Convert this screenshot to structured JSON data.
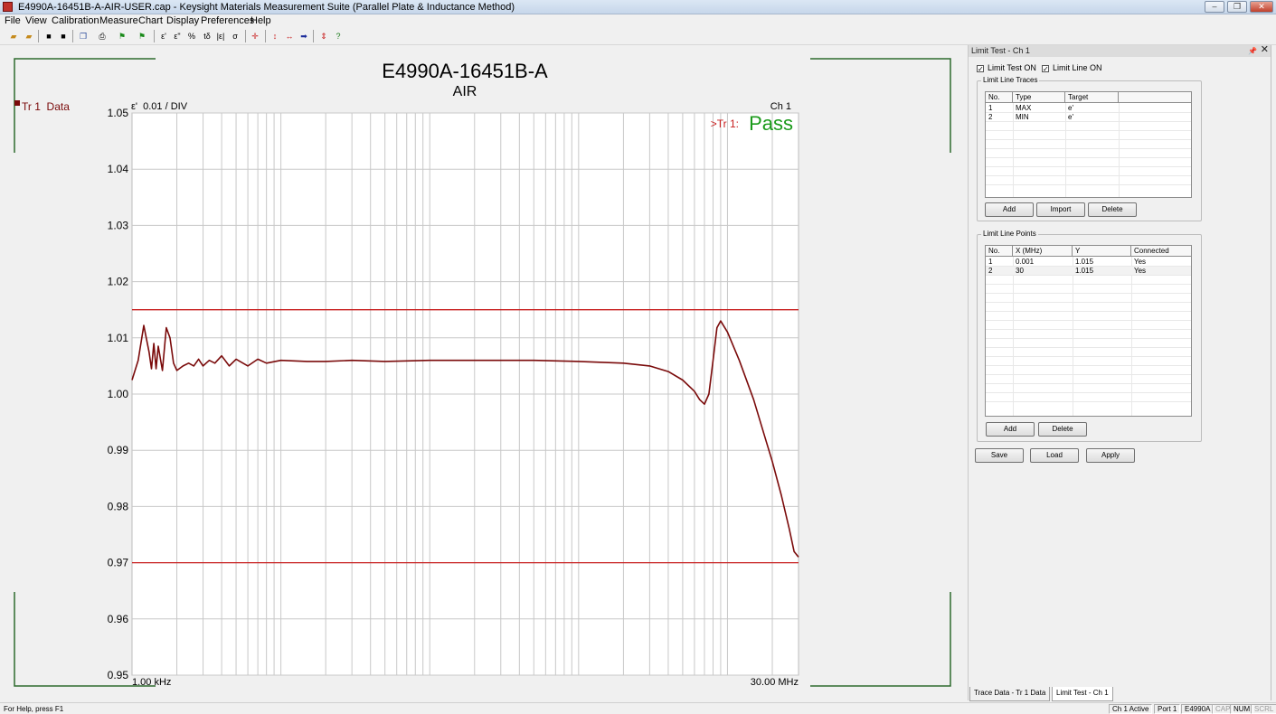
{
  "window": {
    "title": "E4990A-16451B-A-AIR-USER.cap - Keysight Materials Measurement Suite (Parallel Plate & Inductance Method)",
    "controls": [
      "minimize",
      "restore",
      "close"
    ]
  },
  "menu": [
    "File",
    "View",
    "Calibration",
    "Measure",
    "Chart",
    "Display",
    "Preferences",
    "Help"
  ],
  "toolbar": {
    "buttons": [
      "open-icon",
      "open-folder-icon",
      "save-icon",
      "save-as-icon",
      "copy-icon",
      "print-icon",
      "flag-green-icon",
      "flag-red-icon",
      "e-prime-icon",
      "e-double-prime-icon",
      "percent-icon",
      "tan-delta-icon",
      "abs-e-icon",
      "sigma-icon",
      "marker-icon",
      "arrow-vertical-icon",
      "arrow-horizontal-icon",
      "arrow-right-icon",
      "limit-icon",
      "help-icon"
    ],
    "labels": {
      "e1": "ε'",
      "e2": "ε\"",
      "pct": "%",
      "tand": "tδ",
      "abs": "|ε|",
      "sigma": "σ"
    }
  },
  "chart": {
    "title": "E4990A-16451B-A",
    "subtitle": "AIR",
    "trace_label": "Tr 1  Data",
    "scale_label": "ε'  0.01 / DIV",
    "channel_label": "Ch 1",
    "limit_result_prefix": ">Tr 1:",
    "limit_result": "Pass",
    "x_start_label": "1.00 kHz",
    "x_end_label": "30.00 MHz",
    "colors": {
      "trace": "#7a0a0a",
      "limit": "#c81e1e",
      "pass": "#1a9a1a",
      "frame": "#2d6b2d",
      "grid": "#c8c8c8"
    }
  },
  "chart_data": {
    "type": "line",
    "title": "E4990A-16451B-A",
    "subtitle": "AIR",
    "xscale": "log",
    "xlim_hz": [
      1000,
      30000000
    ],
    "ylim": [
      0.95,
      1.05
    ],
    "ylabel": "ε'",
    "yticks": [
      "1.05",
      "1.04",
      "1.03",
      "1.02",
      "1.01",
      "1.00",
      "0.99",
      "0.98",
      "0.97",
      "0.96",
      "0.95"
    ],
    "grid": true,
    "limit_lines": [
      {
        "name": "MAX",
        "y": 1.015
      },
      {
        "name": "MIN",
        "y": 0.97
      }
    ],
    "series": [
      {
        "name": "Tr 1 Data",
        "x_hz": [
          1000,
          1100,
          1200,
          1300,
          1350,
          1400,
          1450,
          1500,
          1600,
          1700,
          1800,
          1900,
          2000,
          2200,
          2400,
          2600,
          2800,
          3000,
          3300,
          3600,
          4000,
          4500,
          5000,
          6000,
          7000,
          8000,
          10000,
          15000,
          20000,
          30000,
          50000,
          100000,
          200000,
          500000,
          1000000,
          2000000,
          3000000,
          4000000,
          5000000,
          6000000,
          6500000,
          7000000,
          7500000,
          8000000,
          8500000,
          9000000,
          10000000,
          12000000,
          15000000,
          18000000,
          20000000,
          23000000,
          26000000,
          28000000,
          30000000
        ],
        "y": [
          1.0025,
          1.006,
          1.0122,
          1.0075,
          1.0045,
          1.009,
          1.0045,
          1.0085,
          1.0042,
          1.0118,
          1.01,
          1.0055,
          1.0042,
          1.005,
          1.0055,
          1.005,
          1.0062,
          1.005,
          1.006,
          1.0055,
          1.0068,
          1.005,
          1.0062,
          1.005,
          1.0062,
          1.0055,
          1.006,
          1.0058,
          1.0058,
          1.006,
          1.0058,
          1.006,
          1.006,
          1.006,
          1.0058,
          1.0055,
          1.005,
          1.004,
          1.0025,
          1.0005,
          0.999,
          0.9982,
          1.0,
          1.006,
          1.0118,
          1.013,
          1.011,
          1.006,
          0.999,
          0.992,
          0.988,
          0.982,
          0.976,
          0.972,
          0.971
        ]
      }
    ]
  },
  "panel": {
    "title": "Limit Test - Ch 1",
    "pin_glyph": "📌",
    "close_glyph": "✕",
    "limit_test_on": "Limit Test ON",
    "limit_line_on": "Limit Line ON",
    "traces_group": "Limit Line Traces",
    "traces_columns": [
      "No.",
      "Type",
      "Target",
      ""
    ],
    "traces_rows": [
      [
        "1",
        "MAX",
        "e'"
      ],
      [
        "2",
        "MIN",
        "e'"
      ]
    ],
    "traces_buttons": [
      "Add",
      "Import",
      "Delete"
    ],
    "points_group": "Limit Line Points",
    "points_columns": [
      "No.",
      "X (MHz)",
      "Y",
      "Connected"
    ],
    "points_rows": [
      [
        "1",
        "0.001",
        "1.015",
        "Yes"
      ],
      [
        "2",
        "30",
        "1.015",
        "Yes"
      ]
    ],
    "points_buttons": [
      "Add",
      "Delete"
    ],
    "bottom_buttons": [
      "Save",
      "Load",
      "Apply"
    ]
  },
  "panel_tabs": [
    "Trace Data - Tr 1  Data",
    "Limit Test - Ch 1"
  ],
  "status": {
    "help": "For Help, press F1",
    "panels": [
      "Ch 1 Active",
      "Port 1",
      "E4990A",
      "CAP",
      "NUM",
      "SCRL"
    ]
  }
}
